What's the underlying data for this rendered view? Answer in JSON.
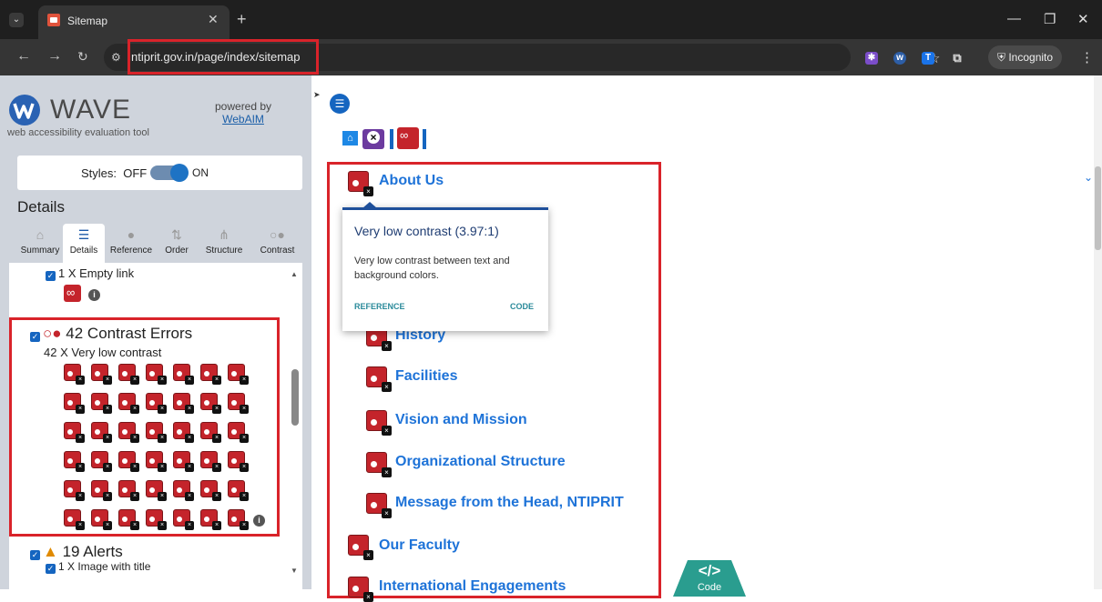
{
  "browser": {
    "tab_title": "Sitemap",
    "url": "ntiprit.gov.in/page/index/sitemap",
    "incognito_label": "Incognito",
    "icons": [
      "chevron-down-icon",
      "close-icon",
      "plus-icon",
      "minimize-icon",
      "restore-icon",
      "back-icon",
      "forward-icon",
      "reload-icon",
      "site-info-icon",
      "star-icon",
      "extension-icon",
      "kebab-icon"
    ]
  },
  "wave": {
    "logo_text": "WAVE",
    "subtitle": "web accessibility evaluation tool",
    "powered_by": "powered by",
    "webaim": "WebAIM",
    "styles_label": "Styles:",
    "styles_off": "OFF",
    "styles_on": "ON",
    "details_heading": "Details",
    "tabs": [
      {
        "label": "Summary",
        "icon": "home-icon"
      },
      {
        "label": "Details",
        "icon": "list-icon"
      },
      {
        "label": "Reference",
        "icon": "info-icon"
      },
      {
        "label": "Order",
        "icon": "order-icon"
      },
      {
        "label": "Structure",
        "icon": "structure-icon"
      },
      {
        "label": "Contrast",
        "icon": "contrast-icon"
      }
    ],
    "empty_link": "1 X Empty link",
    "contrast_heading": "42 Contrast Errors",
    "very_low_contrast": "42 X Very low contrast",
    "contrast_count": 42,
    "alerts_heading": "19 Alerts",
    "image_with_title": "1 X Image with title"
  },
  "page": {
    "links": [
      "About Us",
      "History",
      "Facilities",
      "Vision and Mission",
      "Organizational Structure",
      "Message from the Head, NTIPRIT",
      "Our Faculty",
      "International Engagements"
    ],
    "tooltip": {
      "title": "Very low contrast (3.97:1)",
      "description": "Very low contrast between text and background colors.",
      "reference": "REFERENCE",
      "code": "CODE"
    },
    "code_button": "Code",
    "code_glyph": "</>"
  },
  "colors": {
    "error_red": "#c4242b",
    "highlight_red": "#d9232a",
    "wave_blue": "#1565c0",
    "link_blue": "#1e73d8"
  }
}
